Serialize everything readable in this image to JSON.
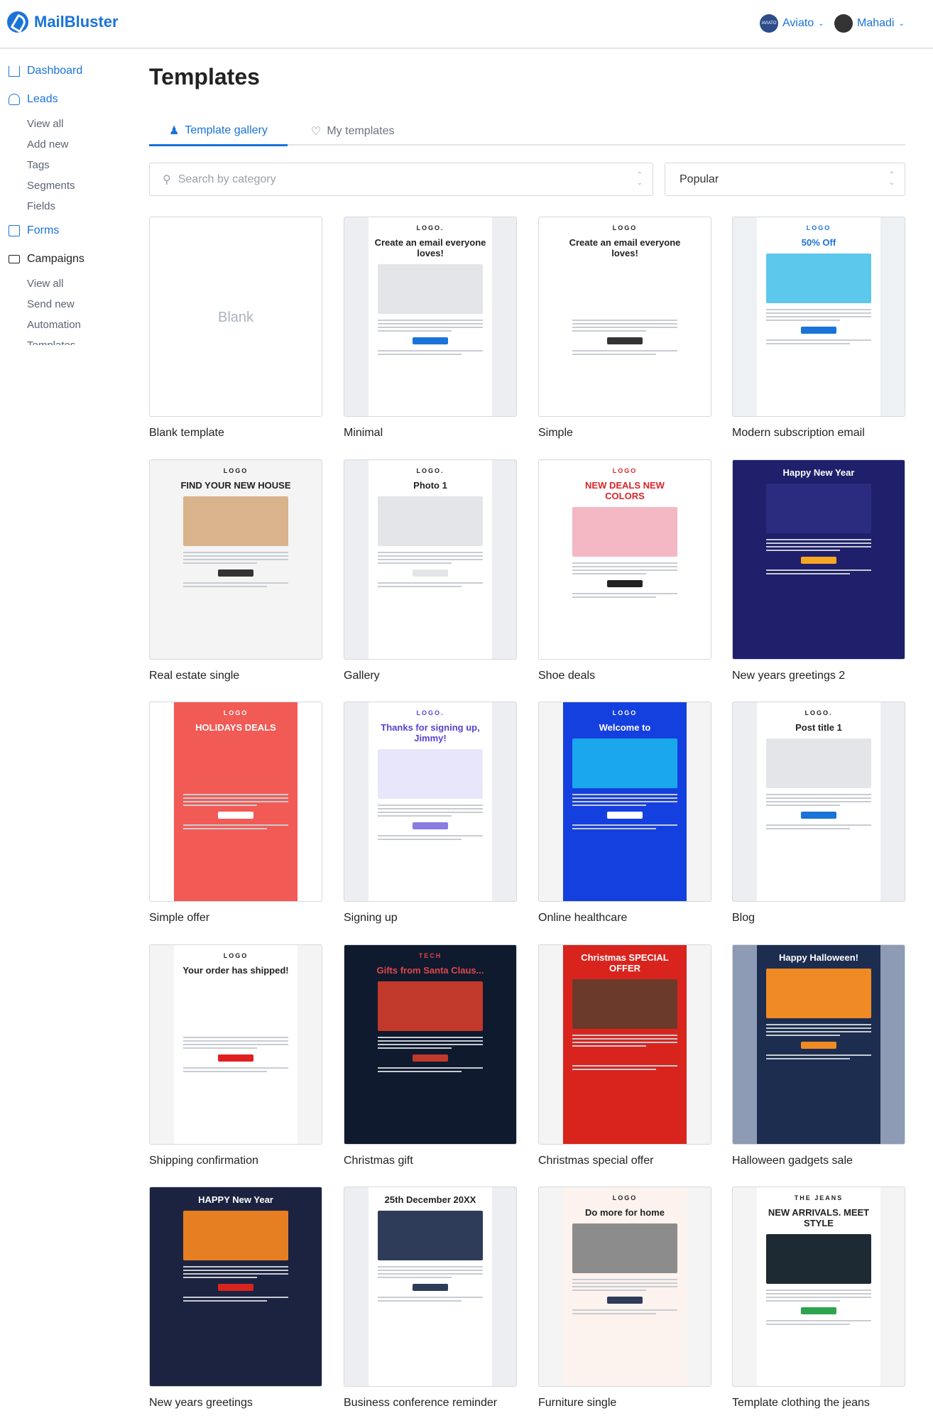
{
  "app": {
    "name": "MailBluster"
  },
  "header": {
    "accounts": [
      {
        "name": "Aviato",
        "avatar_text": "AVIATO"
      },
      {
        "name": "Mahadi"
      }
    ]
  },
  "sidebar": {
    "dashboard": "Dashboard",
    "leads": {
      "label": "Leads",
      "items": [
        "View all",
        "Add new",
        "Tags",
        "Segments",
        "Fields"
      ]
    },
    "forms": "Forms",
    "campaigns": {
      "label": "Campaigns",
      "items": [
        "View all",
        "Send new",
        "Automation",
        "Templates"
      ]
    }
  },
  "page": {
    "title": "Templates"
  },
  "tabs": [
    {
      "label": "Template gallery",
      "icon": "user-icon",
      "active": true
    },
    {
      "label": "My templates",
      "icon": "heart-icon",
      "active": false
    }
  ],
  "search": {
    "placeholder": "Search by category"
  },
  "sort": {
    "value": "Popular"
  },
  "accent": "#1a73d9",
  "templates": [
    {
      "name": "Blank template",
      "blank": "Blank",
      "bg": "#ffffff"
    },
    {
      "name": "Minimal",
      "bg": "#eceef1",
      "panel": "#ffffff",
      "logo": "LOGO.",
      "headline": "Create an email everyone loves!",
      "img": "#e3e5e9",
      "btn": "#1a73d9"
    },
    {
      "name": "Simple",
      "bg": "#ffffff",
      "panel": "#ffffff",
      "logo": "LOGO",
      "headline": "Create an email everyone loves!",
      "img": "#ffffff",
      "btn": "#333333"
    },
    {
      "name": "Modern subscription email",
      "bg": "#eef1f4",
      "panel": "#ffffff",
      "logo": "LOGO",
      "headline": "50% Off",
      "img": "#5cc8ec",
      "btn": "#1a73d9",
      "hcolor": "#1a73d9"
    },
    {
      "name": "Real estate single",
      "bg": "#f4f4f4",
      "panel": "#f4f4f4",
      "logo": "LOGO",
      "headline": "FIND YOUR NEW HOUSE",
      "img": "#d9b38c",
      "btn": "#333333"
    },
    {
      "name": "Gallery",
      "bg": "#eceef1",
      "panel": "#ffffff",
      "logo": "LOGO.",
      "headline": "Photo 1",
      "img": "#e3e5e9",
      "btn": "#e3e5e9"
    },
    {
      "name": "Shoe deals",
      "bg": "#ffffff",
      "panel": "#ffffff",
      "logo": "LOGO",
      "headline": "NEW DEALS NEW COLORS",
      "img": "#f3b8c4",
      "btn": "#222222",
      "hcolor": "#d9252a"
    },
    {
      "name": "New years greetings 2",
      "bg": "#1f1f6b",
      "panel": "#1f1f6b",
      "logo": "",
      "headline": "Happy New Year",
      "img": "#2b2b80",
      "btn": "#f5a623",
      "hcolor": "#ffffff"
    },
    {
      "name": "Simple offer",
      "bg": "#ffffff",
      "panel": "#f25a55",
      "logo": "LOGO",
      "headline": "HOLIDAYS DEALS",
      "img": "#f25a55",
      "btn": "#ffffff",
      "hcolor": "#ffffff"
    },
    {
      "name": "Signing up",
      "bg": "#eceef1",
      "panel": "#ffffff",
      "logo": "LOGO.",
      "headline": "Thanks for signing up, Jimmy!",
      "img": "#e8e6fb",
      "btn": "#8a7be0",
      "hcolor": "#5b3fd1"
    },
    {
      "name": "Online healthcare",
      "bg": "#f4f4f4",
      "panel": "#1440e0",
      "logo": "LOGO",
      "headline": "Welcome to",
      "img": "#1aa7ec",
      "btn": "#ffffff",
      "hcolor": "#ffffff"
    },
    {
      "name": "Blog",
      "bg": "#eceef1",
      "panel": "#ffffff",
      "logo": "LOGO.",
      "headline": "Post title 1",
      "img": "#e3e5e9",
      "btn": "#1a73d9"
    },
    {
      "name": "Shipping confirmation",
      "bg": "#f4f4f4",
      "panel": "#ffffff",
      "logo": "LOGO",
      "headline": "Your order has shipped!",
      "img": "#ffffff",
      "btn": "#e02020"
    },
    {
      "name": "Christmas gift",
      "bg": "#0f1a2e",
      "panel": "#0f1a2e",
      "logo": "TECH",
      "headline": "Gifts from Santa Claus...",
      "img": "#c0392b",
      "btn": "#c0392b",
      "hcolor": "#e0464b"
    },
    {
      "name": "Christmas special offer",
      "bg": "#f4f4f4",
      "panel": "#d9241e",
      "logo": "",
      "headline": "Christmas SPECIAL OFFER",
      "img": "#6b3a2a",
      "btn": "#d9241e",
      "hcolor": "#ffffff"
    },
    {
      "name": "Halloween gadgets sale",
      "bg": "#8d9bb5",
      "panel": "#1c2d4f",
      "logo": "",
      "headline": "Happy Halloween!",
      "img": "#f08a24",
      "btn": "#f08a24",
      "hcolor": "#ffffff"
    },
    {
      "name": "New years greetings",
      "bg": "#1c2340",
      "panel": "#1c2340",
      "logo": "",
      "headline": "HAPPY New Year",
      "img": "#e67e22",
      "btn": "#d9241e",
      "hcolor": "#ffffff"
    },
    {
      "name": "Business conference reminder",
      "bg": "#eceef1",
      "panel": "#ffffff",
      "logo": "",
      "headline": "25th December 20XX",
      "img": "#2e3c5a",
      "btn": "#2e3c5a"
    },
    {
      "name": "Furniture single",
      "bg": "#f4f4f4",
      "panel": "#fdf3ee",
      "logo": "LOGO",
      "headline": "Do more for home",
      "img": "#8c8c8c",
      "btn": "#2e3c5a"
    },
    {
      "name": "Template clothing the jeans",
      "bg": "#f4f4f4",
      "panel": "#ffffff",
      "logo": "THE JEANS",
      "headline": "NEW ARRIVALS. MEET STYLE",
      "img": "#1d2a33",
      "btn": "#2ea44f"
    }
  ]
}
